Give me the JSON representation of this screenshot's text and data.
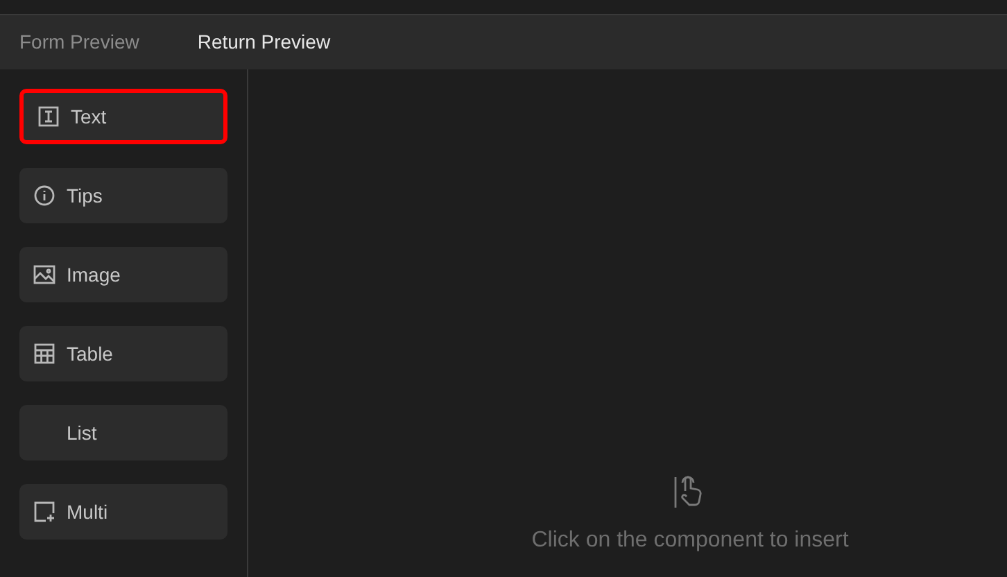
{
  "tabs": [
    {
      "label": "Form Preview",
      "selected": false
    },
    {
      "label": "Return Preview",
      "selected": true
    }
  ],
  "components": [
    {
      "label": "Text",
      "kind": "text",
      "selected": true
    },
    {
      "label": "Tips",
      "kind": "tips",
      "selected": false
    },
    {
      "label": "Image",
      "kind": "image",
      "selected": false
    },
    {
      "label": "Table",
      "kind": "table",
      "selected": false
    },
    {
      "label": "List",
      "kind": "list",
      "selected": false
    },
    {
      "label": "Multi",
      "kind": "multi",
      "selected": false
    }
  ],
  "empty_hint": "Click on the component to insert"
}
